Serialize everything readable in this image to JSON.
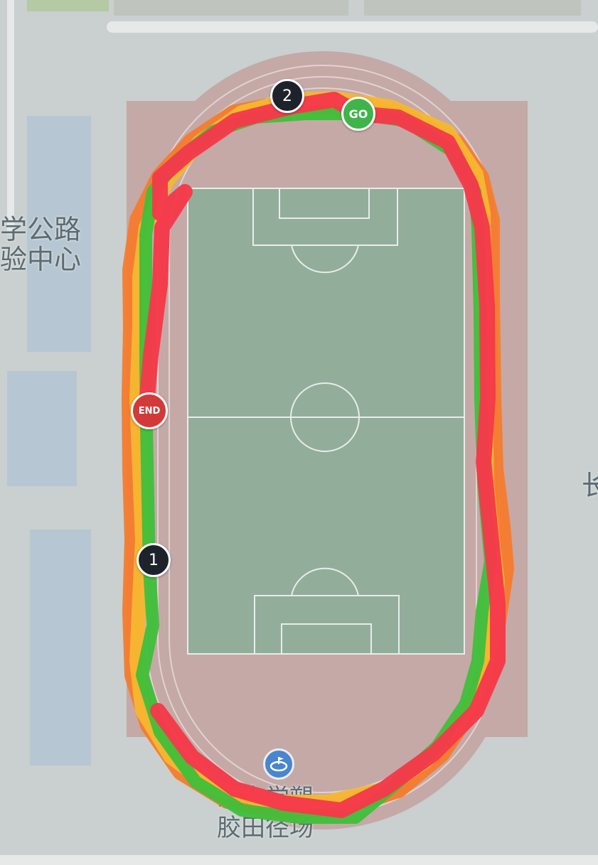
{
  "map": {
    "labels": {
      "building_left_line1": "学公路",
      "building_left_line2": "验中心",
      "right_edge": "长",
      "venue_line1": "东大学塑",
      "venue_line2": "胶田径场"
    },
    "markers": {
      "start": "GO",
      "end": "END",
      "km_1": "1",
      "km_2": "2"
    },
    "poi_icon": "stadium-icon",
    "colors": {
      "background": "#c9d0cf",
      "track_surface": "#c4a9a7",
      "field": "#93ad9b",
      "route_fast": "#3fbf3a",
      "route_medium": "#f5b731",
      "route_slow": "#f57b2c",
      "route_slowest": "#f53a4a",
      "marker_go": "#3fb44a",
      "marker_end": "#d23a3a",
      "marker_km": "#1e232b"
    }
  }
}
